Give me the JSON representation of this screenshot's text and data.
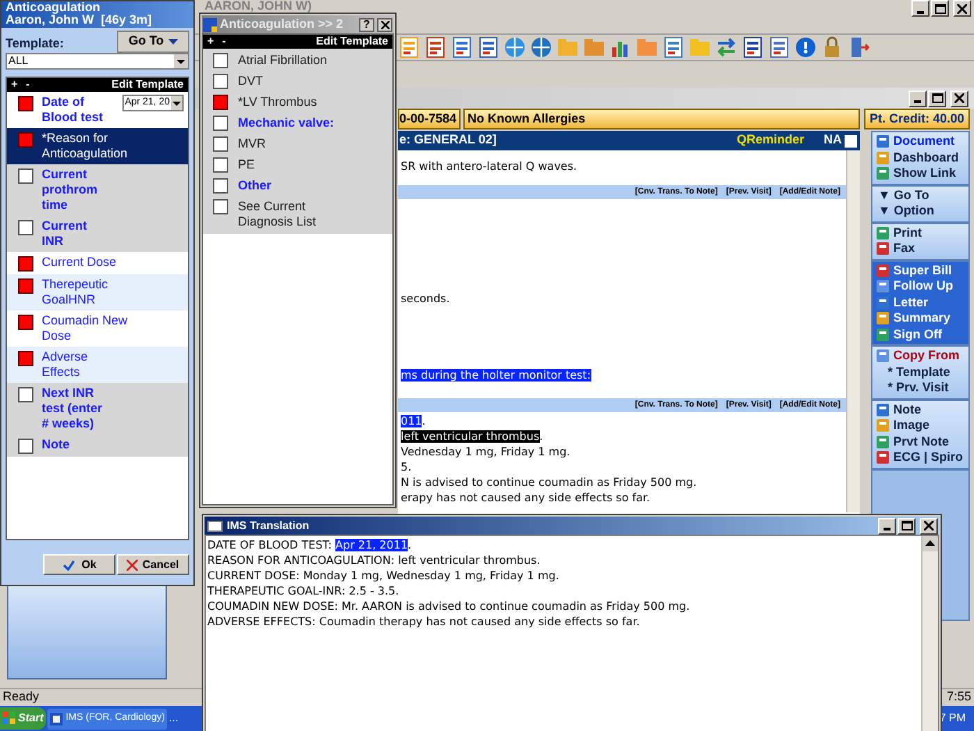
{
  "app": {
    "title": "AARON, JOHN W)"
  },
  "record": {
    "id": "0-00-7584",
    "allergies": "No Known Allergies",
    "credit": "Pt. Credit: 40.00"
  },
  "note_header": {
    "title": "e: GENERAL 02]",
    "reminder": "QReminder",
    "na_label": "NA",
    "na_checked": false
  },
  "note_lines": [
    {
      "kind": "line",
      "segments": [
        {
          "text": "SR with antero-lateral Q waves.",
          "selected": false,
          "inverse": false
        }
      ]
    },
    {
      "kind": "links",
      "links": [
        "[Cnv. Trans. To Note]",
        "[Prev. Visit]",
        "[Add/Edit Note]"
      ]
    },
    {
      "kind": "line",
      "segments": [
        {
          "text": "seconds.",
          "selected": false,
          "inverse": false
        }
      ]
    },
    {
      "kind": "line",
      "segments": [
        {
          "text": "ms during the holter monitor test:",
          "selected": true,
          "inverse": false
        }
      ]
    },
    {
      "kind": "links",
      "links": [
        "[Cnv. Trans. To Note]",
        "[Prev. Visit]",
        "[Add/Edit Note]"
      ]
    },
    {
      "kind": "line",
      "segments": [
        {
          "text": "011",
          "selected": true,
          "inverse": false
        },
        {
          "text": ".",
          "selected": false,
          "inverse": false
        }
      ]
    },
    {
      "kind": "line",
      "segments": [
        {
          "text": "left ventricular thrombus",
          "selected": false,
          "inverse": true
        },
        {
          "text": ".",
          "selected": false,
          "inverse": false
        }
      ]
    },
    {
      "kind": "line",
      "segments": [
        {
          "text": "Vednesday 1 mg, Friday 1 mg.",
          "selected": false,
          "inverse": false
        }
      ]
    },
    {
      "kind": "line",
      "segments": [
        {
          "text": "5.",
          "selected": false,
          "inverse": false
        }
      ]
    },
    {
      "kind": "line",
      "segments": [
        {
          "text": "N is advised to continue coumadin as Friday 500 mg.",
          "selected": false,
          "inverse": false
        }
      ]
    },
    {
      "kind": "line",
      "segments": [
        {
          "text": "erapy has not caused any side effects so far.",
          "selected": false,
          "inverse": false
        }
      ]
    }
  ],
  "sidebar": {
    "groups": [
      {
        "kind": "light",
        "items": [
          {
            "label": "Document",
            "kind": "icon",
            "color": "#0020e0"
          },
          {
            "label": "Dashboard",
            "kind": "icon",
            "color": "#102040"
          },
          {
            "label": "Show Link",
            "kind": "icon",
            "color": "#102040"
          }
        ]
      },
      {
        "kind": "light",
        "items": [
          {
            "label": "▼ Go To",
            "kind": "menu",
            "color": "#102040"
          },
          {
            "label": "▼ Option",
            "kind": "menu",
            "color": "#102040"
          }
        ]
      },
      {
        "kind": "light",
        "items": [
          {
            "label": "Print",
            "kind": "icon",
            "color": "#102040"
          },
          {
            "label": "Fax",
            "kind": "icon",
            "color": "#102040"
          }
        ]
      },
      {
        "kind": "dark",
        "items": [
          {
            "label": "Super Bill",
            "kind": "icon",
            "color": "#ffffff"
          },
          {
            "label": "Follow Up",
            "kind": "icon",
            "color": "#ffffff"
          },
          {
            "label": "Letter",
            "kind": "icon",
            "color": "#ffffff"
          },
          {
            "label": "Summary",
            "kind": "icon",
            "color": "#ffffff"
          },
          {
            "label": "Sign Off",
            "kind": "icon",
            "color": "#ffffff"
          }
        ]
      },
      {
        "kind": "light",
        "items": [
          {
            "label": "Copy From",
            "kind": "icon",
            "color": "#b00010"
          },
          {
            "label": "* Template",
            "kind": "bullet",
            "color": "#102040"
          },
          {
            "label": "* Prv. Visit",
            "kind": "bullet",
            "color": "#102040"
          }
        ]
      },
      {
        "kind": "light",
        "items": [
          {
            "label": "Note",
            "kind": "icon",
            "color": "#102040"
          },
          {
            "label": "Image",
            "kind": "icon",
            "color": "#102040"
          },
          {
            "label": "Prvt Note",
            "kind": "icon",
            "color": "#102040"
          },
          {
            "label": "ECG | Spiro",
            "kind": "icon",
            "color": "#102040"
          }
        ]
      }
    ]
  },
  "status_bar": {
    "text": "Ready",
    "clock": "7:55"
  },
  "taskbar": {
    "start": "Start",
    "task": "IMS (FOR, Cardiology)",
    "more": "...",
    "clock": "7 PM"
  },
  "template_panel": {
    "title": "Anticoagulation",
    "patient": "Aaron, John W  [46y 3m]",
    "template_label": "Template:",
    "goto": "Go To",
    "template_value": "ALL",
    "plus": "+",
    "minus": "-",
    "header": "Edit Template",
    "ok": "Ok",
    "cancel": "Cancel",
    "items": [
      {
        "label": "Date of Blood test",
        "kind": "date",
        "checked": true,
        "selected": false,
        "value": "Apr 21, 20"
      },
      {
        "label": "*Reason for Anticoagulation",
        "kind": "option",
        "checked": true,
        "selected": true
      },
      {
        "label": "Current prothrom time",
        "kind": "section",
        "checked": false,
        "selected": false
      },
      {
        "label": "Current INR",
        "kind": "section",
        "checked": false,
        "selected": false
      },
      {
        "label": "Current Dose",
        "kind": "option",
        "checked": true,
        "selected": false
      },
      {
        "label": "Therepeutic GoalHNR",
        "kind": "option",
        "checked": true,
        "selected": false
      },
      {
        "label": "Coumadin  New Dose",
        "kind": "option",
        "checked": true,
        "selected": false
      },
      {
        "label": "Adverse Effects",
        "kind": "option",
        "checked": true,
        "selected": false
      },
      {
        "label": "Next INR test (enter # weeks)",
        "kind": "section",
        "checked": false,
        "selected": false
      },
      {
        "label": "Note",
        "kind": "section",
        "checked": false,
        "selected": false
      }
    ]
  },
  "subtemplate": {
    "title": "Anticoagulation >> 2",
    "help": "?",
    "plus": "+",
    "minus": "-",
    "header": "Edit Template",
    "items": [
      {
        "label": "Atrial Fibrillation",
        "kind": "option",
        "checked": false
      },
      {
        "label": "DVT",
        "kind": "option",
        "checked": false
      },
      {
        "label": "*LV Thrombus",
        "kind": "option",
        "checked": true
      },
      {
        "label": "Mechanic valve:",
        "kind": "section",
        "checked": false
      },
      {
        "label": "MVR",
        "kind": "option",
        "checked": false
      },
      {
        "label": "PE",
        "kind": "option",
        "checked": false
      },
      {
        "label": "Other",
        "kind": "section",
        "checked": false
      },
      {
        "label": "See Current Diagnosis List",
        "kind": "option",
        "checked": false
      }
    ]
  },
  "translation": {
    "title": "IMS Translation",
    "lines": [
      [
        {
          "text": "DATE OF BLOOD TEST: ",
          "selected": false,
          "inverse": false
        },
        {
          "text": "Apr 21, 2011",
          "selected": true,
          "inverse": false
        },
        {
          "text": ".",
          "selected": false,
          "inverse": false
        }
      ],
      [
        {
          "text": "REASON FOR ANTICOAGULATION: left ventricular thrombus.",
          "selected": false,
          "inverse": false
        }
      ],
      [
        {
          "text": "CURRENT DOSE: Monday 1 mg, Wednesday 1 mg, Friday 1 mg.",
          "selected": false,
          "inverse": false
        }
      ],
      [
        {
          "text": "THERAPEUTIC GOAL-INR: 2.5 - 3.5.",
          "selected": false,
          "inverse": false
        }
      ],
      [
        {
          "text": "COUMADIN NEW DOSE: Mr. AARON is advised to continue coumadin as Friday 500 mg.",
          "selected": false,
          "inverse": false
        }
      ],
      [
        {
          "text": "ADVERSE EFFECTS: Coumadin therapy has not caused any side effects so far.",
          "selected": false,
          "inverse": false
        }
      ]
    ]
  }
}
